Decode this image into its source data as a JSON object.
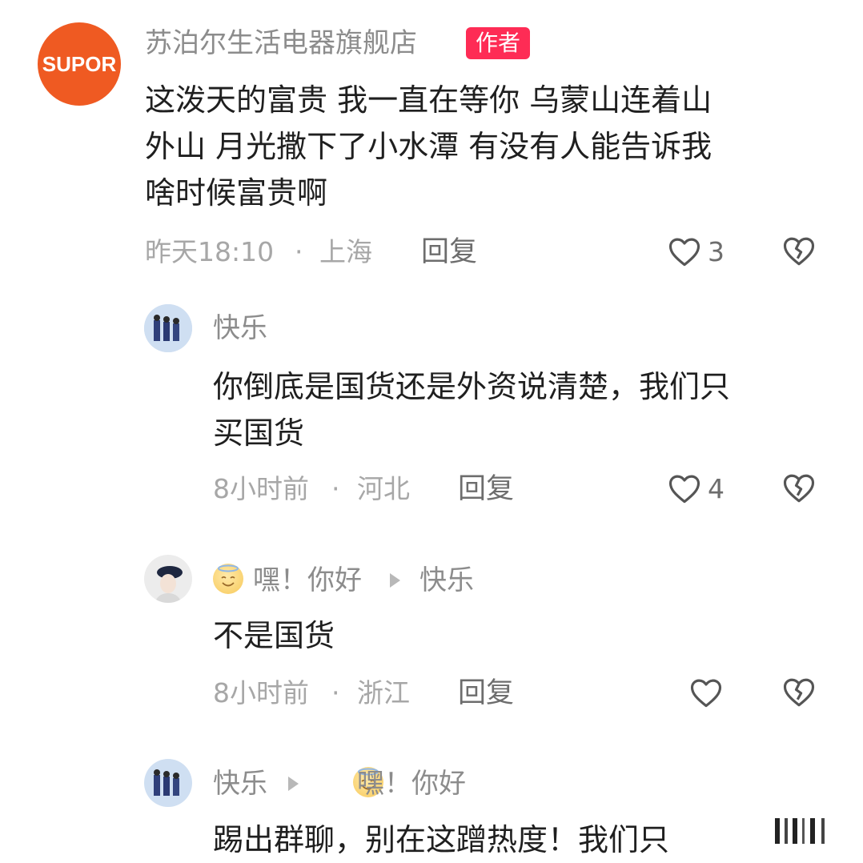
{
  "comment1": {
    "avatar_text": "SUPOR",
    "username": "苏泊尔生活电器旗舰店",
    "badge": "作者",
    "lines": [
      "这泼天的富贵 我一直在等你 乌蒙山连着山",
      "外山 月光撒下了小水潭 有没有人能告诉我",
      "啥时候富贵啊"
    ],
    "time": "昨天18:10",
    "sep": "·",
    "location": "上海",
    "reply": "回复",
    "likes": "3"
  },
  "reply1": {
    "username": "快乐",
    "lines": [
      "你倒底是国货还是外资说清楚，我们只",
      "买国货"
    ],
    "time": "8小时前",
    "sep": "·",
    "location": "河北",
    "reply": "回复",
    "likes": "4"
  },
  "reply2": {
    "username": "嘿！你好",
    "reply_to": "快乐",
    "lines": [
      "不是国货"
    ],
    "time": "8小时前",
    "sep": "·",
    "location": "浙江",
    "reply": "回复"
  },
  "reply3": {
    "username": "快乐",
    "reply_to": "嘿！你好",
    "lines": [
      "踢出群聊，别在这蹭热度！我们只"
    ]
  },
  "icons": {
    "like": "heart-outline-icon",
    "dislike": "broken-heart-icon"
  }
}
